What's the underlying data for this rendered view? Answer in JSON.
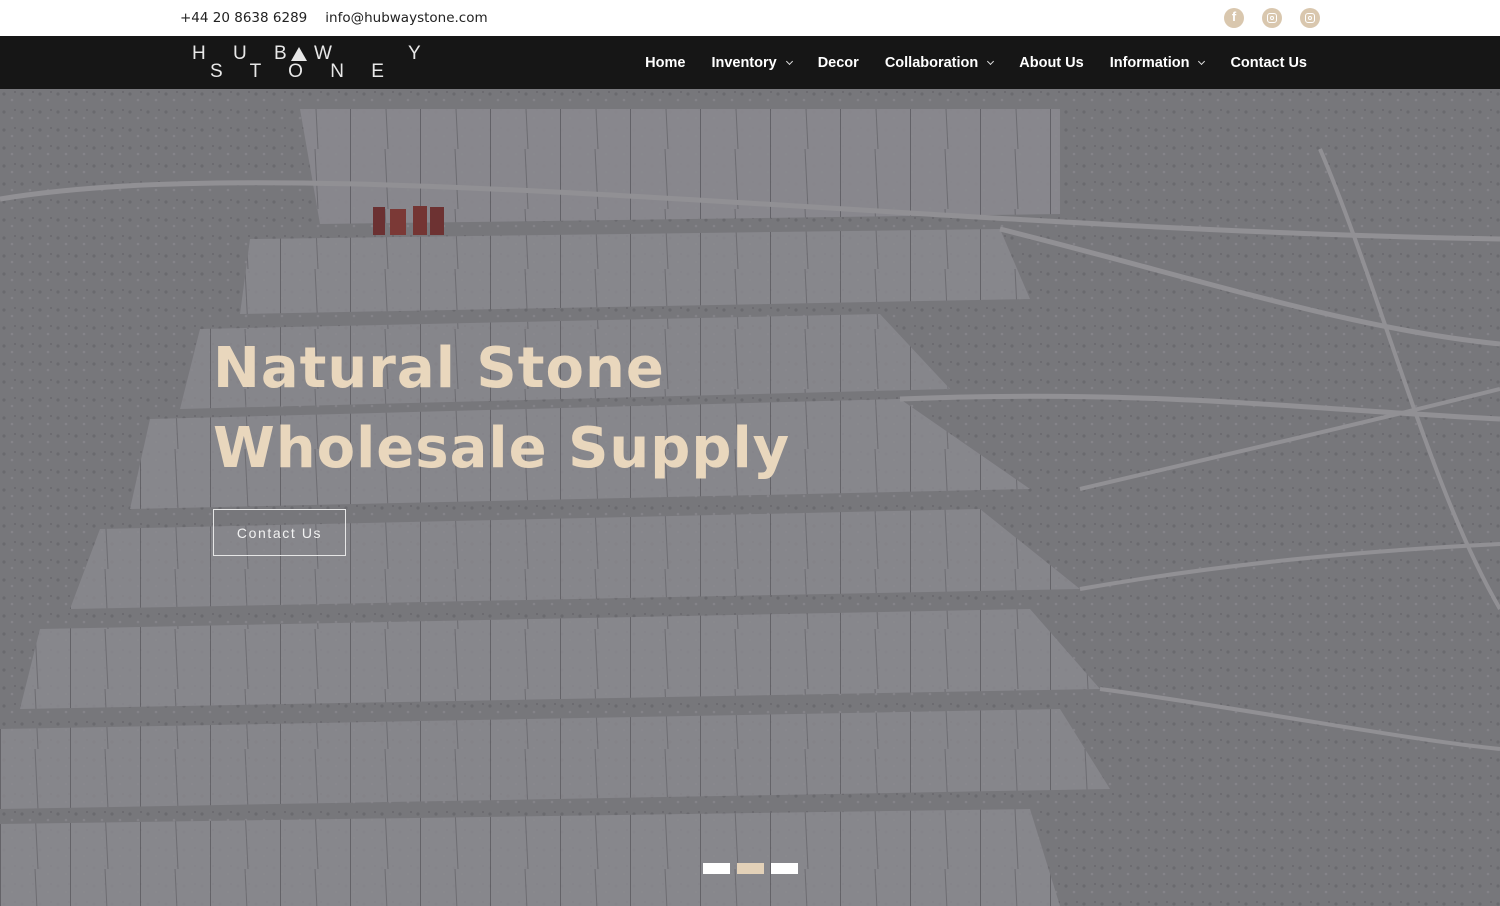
{
  "topbar": {
    "phone": "+44 20 8638 6289",
    "email": "info@hubwaystone.com",
    "socials": [
      "facebook-icon",
      "instagram-icon",
      "instagram-icon"
    ]
  },
  "logo": {
    "line1": "H U B W",
    "line1_end": "Y",
    "line2": "S T O N E"
  },
  "nav": {
    "home": "Home",
    "inventory": "Inventory",
    "decor": "Decor",
    "collaboration": "Collaboration",
    "about": "About Us",
    "information": "Information",
    "contact": "Contact Us"
  },
  "hero": {
    "title_line1": "Natural Stone",
    "title_line2": "Wholesale Supply",
    "cta": "Contact Us",
    "slides": 3,
    "active_slide": 2
  },
  "colors": {
    "accent": "#e9d7bd",
    "nav_bg": "#161616",
    "social": "#d9c7ae"
  }
}
